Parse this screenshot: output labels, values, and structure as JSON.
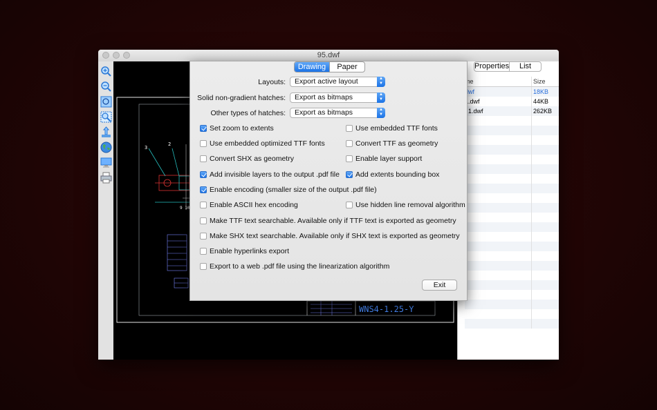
{
  "window": {
    "title": "95.dwf"
  },
  "tools": [
    "zoom-in-icon",
    "zoom-out-icon",
    "zoom-extents-icon",
    "zoom-window-icon",
    "pan-icon",
    "globe-icon",
    "monitor-icon",
    "print-icon"
  ],
  "right_panel": {
    "tabs": [
      "Properties",
      "List"
    ],
    "columns": [
      "me",
      "Size"
    ],
    "rows": [
      {
        "name": "dwf",
        "size": "18KB",
        "highlight": true
      },
      {
        "name": "1.dwf",
        "size": "44KB",
        "highlight": false
      },
      {
        "name": "f 1.dwf",
        "size": "262KB",
        "highlight": false
      }
    ]
  },
  "drawing": {
    "title_block_text": "WNS4-1.25-Y",
    "callouts": [
      "3",
      "2"
    ],
    "dim_text": "9  10"
  },
  "dialog": {
    "tabs": [
      "Drawing",
      "Paper"
    ],
    "active_tab": "Drawing",
    "fields": [
      {
        "label": "Layouts:",
        "value": "Export active layout"
      },
      {
        "label": "Solid non-gradient hatches:",
        "value": "Export as bitmaps"
      },
      {
        "label": "Other types of hatches:",
        "value": "Export as bitmaps"
      }
    ],
    "options": {
      "set_zoom": {
        "label": "Set zoom to extents",
        "checked": true
      },
      "emb_ttf": {
        "label": "Use embedded TTF fonts",
        "checked": false
      },
      "emb_opt_ttf": {
        "label": "Use embedded optimized TTF fonts",
        "checked": false
      },
      "ttf_geom": {
        "label": "Convert TTF as geometry",
        "checked": false
      },
      "shx_geom": {
        "label": "Convert SHX as geometry",
        "checked": false
      },
      "layer_support": {
        "label": "Enable layer support",
        "checked": false
      },
      "invisible_layers": {
        "label": "Add invisible layers to the output .pdf file",
        "checked": true
      },
      "extents_box": {
        "label": "Add extents bounding box",
        "checked": true
      },
      "encoding": {
        "label": "Enable encoding (smaller size of the output .pdf file)",
        "checked": true
      },
      "ascii_hex": {
        "label": "Enable ASCII hex encoding",
        "checked": false
      },
      "hidden_line": {
        "label": "Use hidden line removal algorithm",
        "checked": false
      },
      "ttf_search": {
        "label": "Make TTF text searchable. Available only if TTF text is exported as geometry",
        "checked": false
      },
      "shx_search": {
        "label": "Make SHX text searchable. Available only if SHX text is exported as geometry",
        "checked": false
      },
      "hyperlinks": {
        "label": "Enable hyperlinks export",
        "checked": false
      },
      "web_pdf": {
        "label": "Export to a web .pdf file using the linearization algorithm",
        "checked": false
      }
    },
    "exit_label": "Exit"
  }
}
